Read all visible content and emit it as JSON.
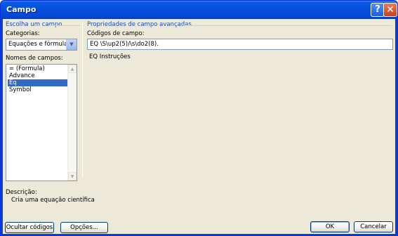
{
  "window": {
    "title": "Campo"
  },
  "left_panel": {
    "group_label": "Escolha um campo",
    "categories_label": "Categorias:",
    "categories_value": "Equações e fórmulas",
    "field_names_label": "Nomes de campos:",
    "field_names": [
      "= (Formula)",
      "Advance",
      "Eq",
      "Symbol"
    ],
    "selected_index": 2
  },
  "right_panel": {
    "group_label": "Propriedades de campo avançadas",
    "codes_label": "Códigos de campo:",
    "codes_value": "EQ \\S\\up2(5)/\\s\\do2(8).",
    "instructions_label": "EQ Instruções"
  },
  "description": {
    "label": "Descrição:",
    "text": "Cria uma equação científica"
  },
  "buttons": {
    "hide_codes": "Ocultar códigos",
    "options": "Opções...",
    "ok": "OK",
    "cancel": "Cancelar"
  },
  "colors": {
    "titlebar": "#0546d5",
    "dialog_bg": "#ece9d8",
    "group_label": "#1f4cc2",
    "selection": "#316ac5"
  }
}
